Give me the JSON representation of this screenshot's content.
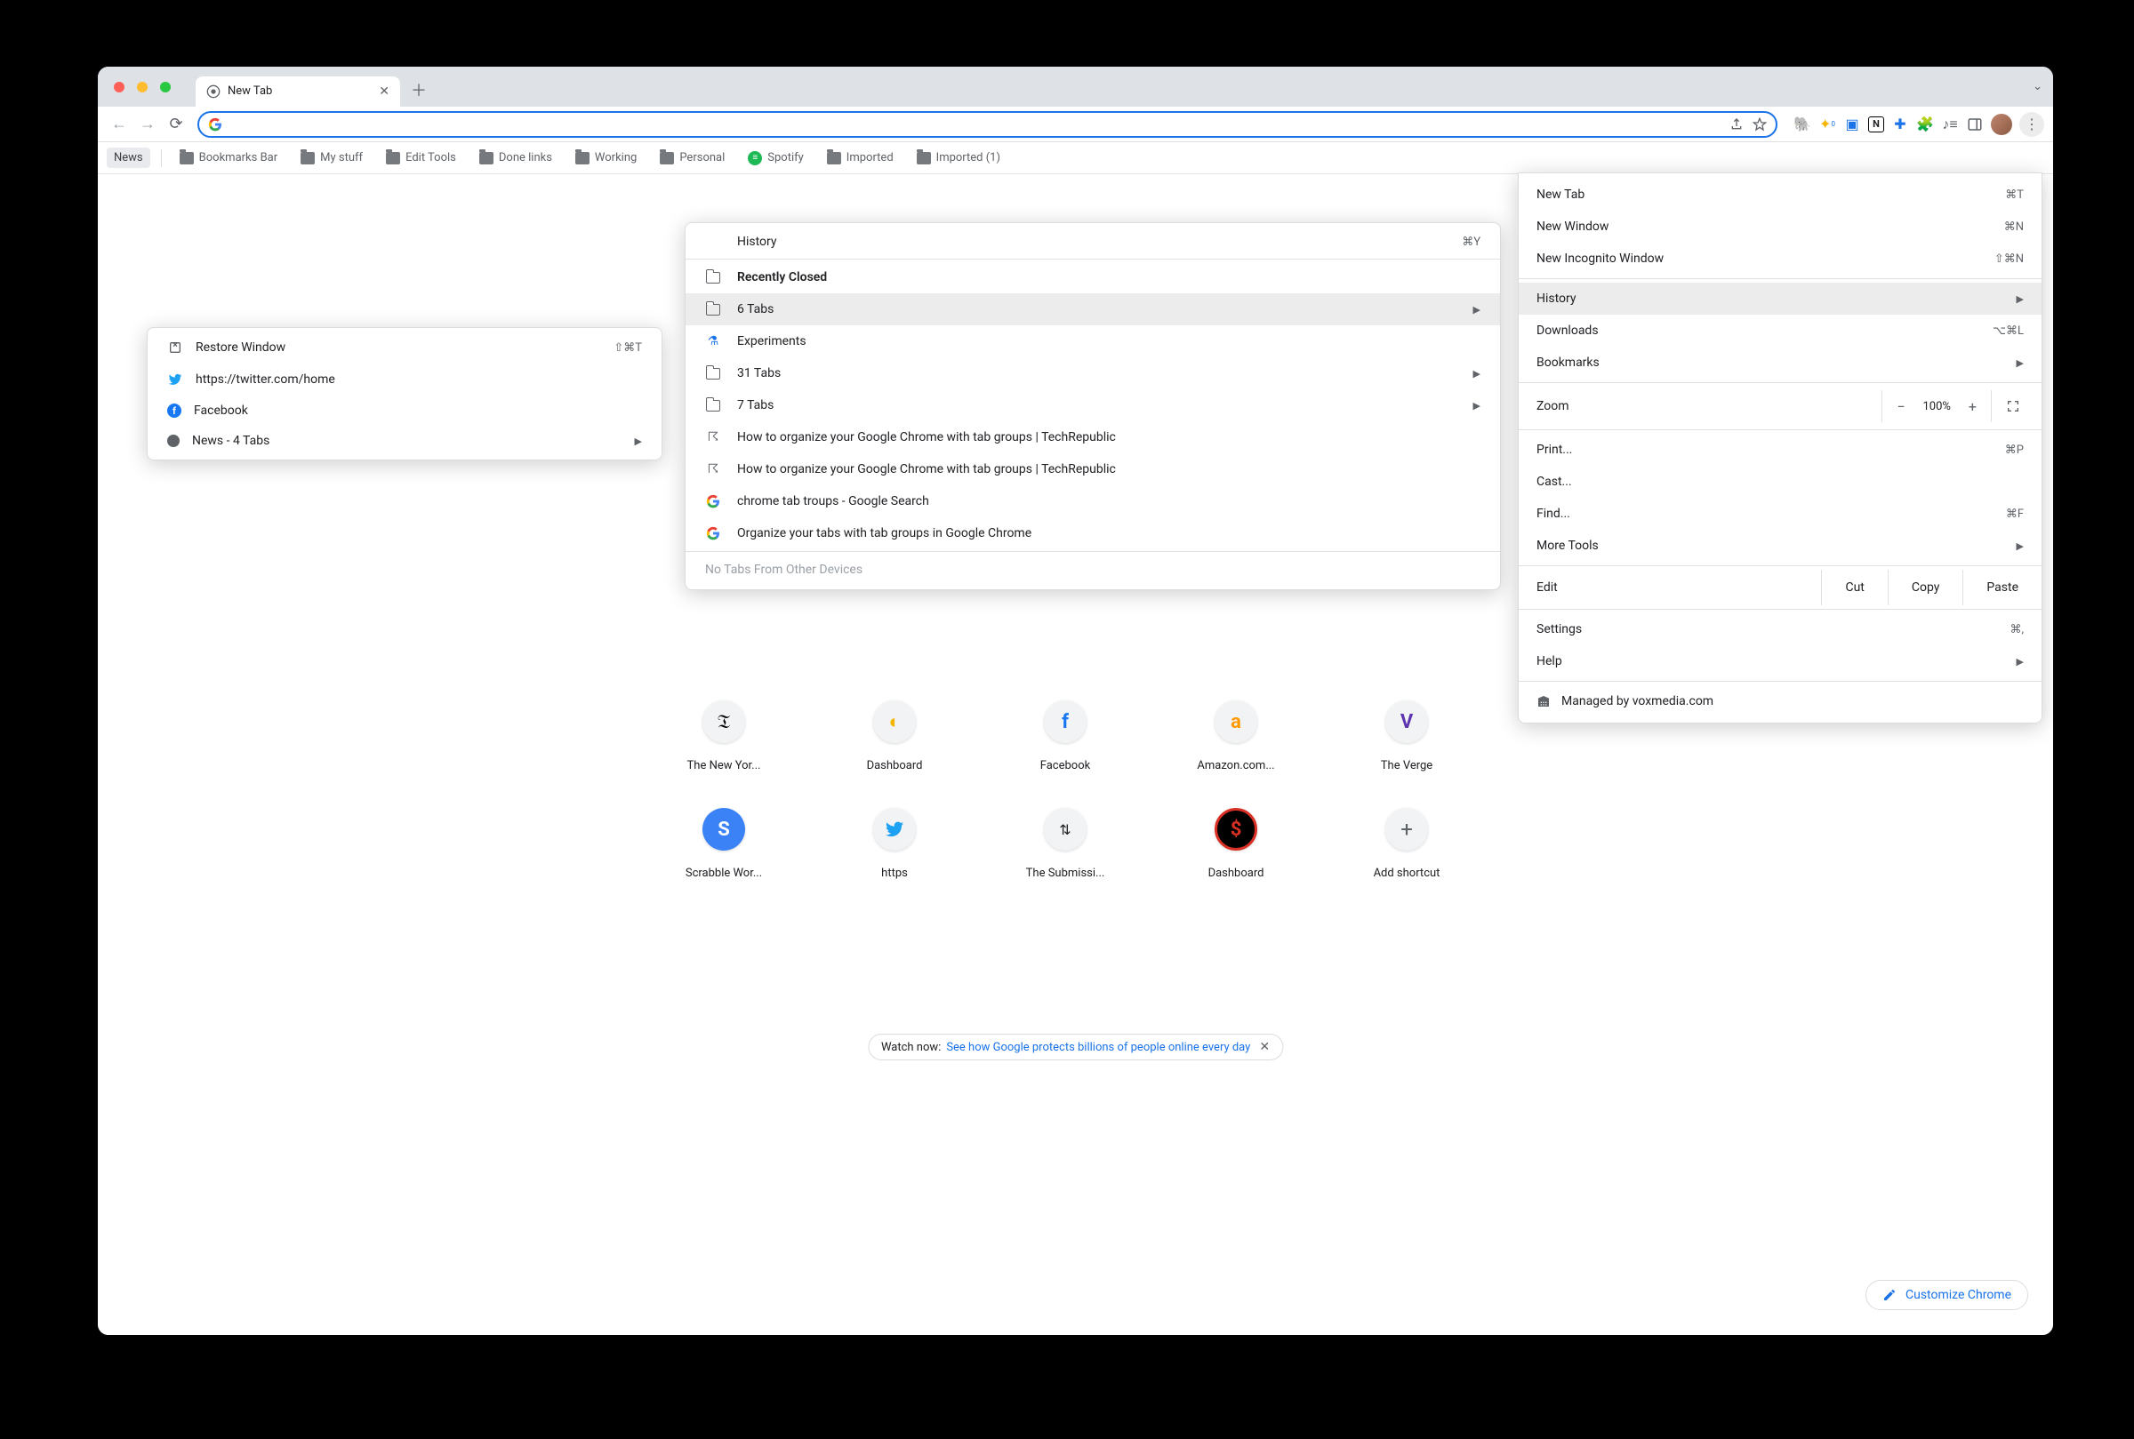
{
  "tab": {
    "title": "New Tab"
  },
  "bookmarks": [
    {
      "label": "News",
      "type": "tag"
    },
    {
      "label": "Bookmarks Bar",
      "type": "folder"
    },
    {
      "label": "My stuff",
      "type": "folder"
    },
    {
      "label": "Edit Tools",
      "type": "folder"
    },
    {
      "label": "Done links",
      "type": "folder"
    },
    {
      "label": "Working",
      "type": "folder"
    },
    {
      "label": "Personal",
      "type": "folder"
    },
    {
      "label": "Spotify",
      "type": "spotify"
    },
    {
      "label": "Imported",
      "type": "folder"
    },
    {
      "label": "Imported (1)",
      "type": "folder"
    }
  ],
  "menu": {
    "new_tab": {
      "label": "New Tab",
      "shortcut": "⌘T"
    },
    "new_window": {
      "label": "New Window",
      "shortcut": "⌘N"
    },
    "new_incognito": {
      "label": "New Incognito Window",
      "shortcut": "⇧⌘N"
    },
    "history": {
      "label": "History"
    },
    "downloads": {
      "label": "Downloads",
      "shortcut": "⌥⌘L"
    },
    "bookmarks": {
      "label": "Bookmarks"
    },
    "zoom": {
      "label": "Zoom",
      "value": "100%"
    },
    "print": {
      "label": "Print...",
      "shortcut": "⌘P"
    },
    "cast": {
      "label": "Cast..."
    },
    "find": {
      "label": "Find...",
      "shortcut": "⌘F"
    },
    "more_tools": {
      "label": "More Tools"
    },
    "edit": {
      "label": "Edit",
      "cut": "Cut",
      "copy": "Copy",
      "paste": "Paste"
    },
    "settings": {
      "label": "Settings",
      "shortcut": "⌘,"
    },
    "help": {
      "label": "Help"
    },
    "managed": "Managed by voxmedia.com"
  },
  "history_menu": {
    "header": {
      "label": "History",
      "shortcut": "⌘Y"
    },
    "recently_closed": "Recently Closed",
    "items": [
      {
        "icon": "folder",
        "label": "6 Tabs",
        "submenu": true
      },
      {
        "icon": "flask",
        "label": "Experiments"
      },
      {
        "icon": "folder",
        "label": "31 Tabs",
        "submenu": true
      },
      {
        "icon": "folder",
        "label": "7 Tabs",
        "submenu": true
      },
      {
        "icon": "tr",
        "label": "How to organize your Google Chrome with tab groups | TechRepublic"
      },
      {
        "icon": "tr",
        "label": "How to organize your Google Chrome with tab groups | TechRepublic"
      },
      {
        "icon": "google",
        "label": "chrome tab troups - Google Search"
      },
      {
        "icon": "google",
        "label": "Organize your tabs with tab groups in Google Chrome"
      }
    ],
    "footer": "No Tabs From Other Devices"
  },
  "tabs_menu": {
    "items": [
      {
        "icon": "restore",
        "label": "Restore Window",
        "shortcut": "⇧⌘T"
      },
      {
        "icon": "twitter",
        "label": "https://twitter.com/home"
      },
      {
        "icon": "facebook",
        "label": "Facebook"
      },
      {
        "icon": "news",
        "label": "News - 4 Tabs",
        "submenu": true
      }
    ]
  },
  "shortcuts_row1": [
    {
      "label": "The New Yor...",
      "color": "#000"
    },
    {
      "label": "Dashboard",
      "color": "#f4b400"
    },
    {
      "label": "Facebook",
      "color": "#1877f2"
    },
    {
      "label": "Amazon.com...",
      "color": "#ff9900"
    },
    {
      "label": "The Verge",
      "color": "#5e35b1"
    }
  ],
  "shortcuts_row2": [
    {
      "label": "Scrabble Wor...",
      "icon": "S",
      "color": "#3b82f6"
    },
    {
      "label": "https",
      "icon": "tw",
      "color": "#1da1f2"
    },
    {
      "label": "The Submissi...",
      "icon": "sub",
      "color": "#333"
    },
    {
      "label": "Dashboard",
      "icon": "dash",
      "color": "#d93025"
    },
    {
      "label": "Add shortcut",
      "icon": "+",
      "color": "#5f6368"
    }
  ],
  "promo": {
    "prefix": "Watch now: ",
    "link": "See how Google protects billions of people online every day"
  },
  "customize": "Customize Chrome"
}
